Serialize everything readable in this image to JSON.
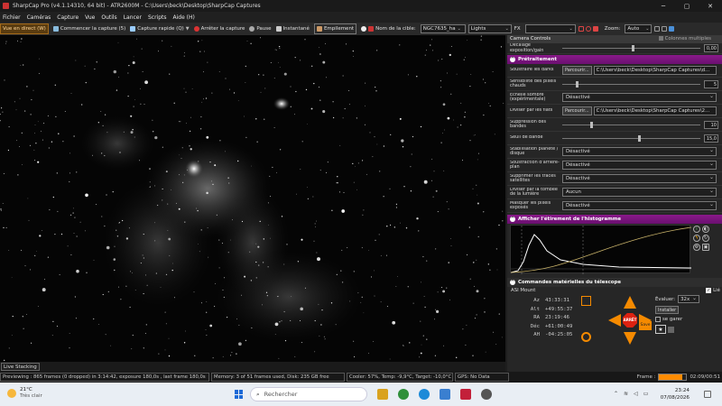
{
  "window": {
    "title": "SharpCap Pro (v4.1.14310, 64 bit) - ATR2600M - C:\\Users\\beck\\Desktop\\SharpCap Captures",
    "controls": [
      "─",
      "▢",
      "✕"
    ]
  },
  "menu": [
    "Fichier",
    "Caméras",
    "Capture",
    "Vue",
    "Outils",
    "Lancer",
    "Scripts",
    "Aide (H)"
  ],
  "toolbar": {
    "live_view": "Vue en direct (W)",
    "start_capture": "Commencer la capture (5)",
    "quick_capture": "Capture rapide (Q)",
    "stop_capture": "Arrêter la capture",
    "pause": "Pause",
    "snapshot": "Instantané",
    "stack": "Empilement",
    "target_label": "Nom de la cible:",
    "target_value": "NGC7635_ha",
    "frame_type": "Lights",
    "fx_label": "FX",
    "zoom_label": "Zoom:",
    "zoom_value": "Auto"
  },
  "panel": {
    "camera_controls_title": "Camera Controls",
    "multiple_columns": "Colonnes multiples",
    "offset_label": "Décalage exposition/gain",
    "offset_value": "0,00",
    "pretraitement_title": "Prétraitement",
    "rows": [
      {
        "label": "Soustraire les darks",
        "button": "Parcourir...",
        "path": "C:\\Users\\beck\\Desktop\\SharpCap Captures\\d..."
      },
      {
        "label": "Sensibilité des pixels chauds",
        "value": "5",
        "knob": 0.1
      },
      {
        "label": "Échelle sombre (expérimentale)",
        "dropdown": "Désactivé"
      },
      {
        "label": "Diviser par les flats",
        "button": "Parcourir...",
        "path": "C:\\Users\\beck\\Desktop\\SharpCap Captures\\2..."
      },
      {
        "label": "Suppression des bandes",
        "value": "10",
        "knob": 0.2
      },
      {
        "label": "Seuil de bande",
        "value": "15,0",
        "knob": 0.55
      },
      {
        "label": "Stabilisation planète / disque",
        "dropdown": "Désactivé"
      },
      {
        "label": "Soustraction d'arrière-plan",
        "dropdown": "Désactivé"
      },
      {
        "label": "Supprimer les traces satellites",
        "dropdown": "Désactivé"
      },
      {
        "label": "Diviser par la tombée de la lumière",
        "dropdown": "Aucun"
      },
      {
        "label": "Masquer les pixels exposés",
        "dropdown": "Désactivé"
      }
    ],
    "histogram_title": "Afficher l'étirement de l'histogramme",
    "telescope_title": "Commandes matérielles du télescope",
    "mount": {
      "name": "ASI Mount",
      "coords": [
        {
          "k": "Az",
          "v": "43:33:31"
        },
        {
          "k": "Alt",
          "v": "+49:55:37"
        },
        {
          "k": "RA",
          "v": "23:19:46"
        },
        {
          "k": "Déc",
          "v": "+61:00:49"
        },
        {
          "k": "AH",
          "v": "-04:25:05"
        }
      ],
      "rate_label": "Évaluer:",
      "rate_value": "32x",
      "install_button": "Installer",
      "park_label": "se garer",
      "save_button": "Save",
      "stop_label": "ARRÊT",
      "link_label": "Lié"
    }
  },
  "livestack_tab": "Live Stacking",
  "status": {
    "previewing": "Previewing : 865 frames (0 dropped) in 3:14:42, exposure 180,0s , last frame 180,0s",
    "memory": "Memory: 3 of 51 frames used, Disk: 235 GB free",
    "cooler": "Cooler: 57%, Temp: -9,9°C, Target: -10,0°C",
    "gps": "GPS: No Data",
    "frame_label": "Frame :",
    "frame_progress": 0.85,
    "frame_time": "02:09/00:51"
  },
  "taskbar": {
    "weather_temp": "21°C",
    "weather_text": "Très clair",
    "search_placeholder": "Rechercher",
    "time": "23:24",
    "date": "07/08/2026"
  },
  "colors": {
    "accent": "#ff8c00",
    "section": "#8a1a8a",
    "panel": "#262626"
  }
}
